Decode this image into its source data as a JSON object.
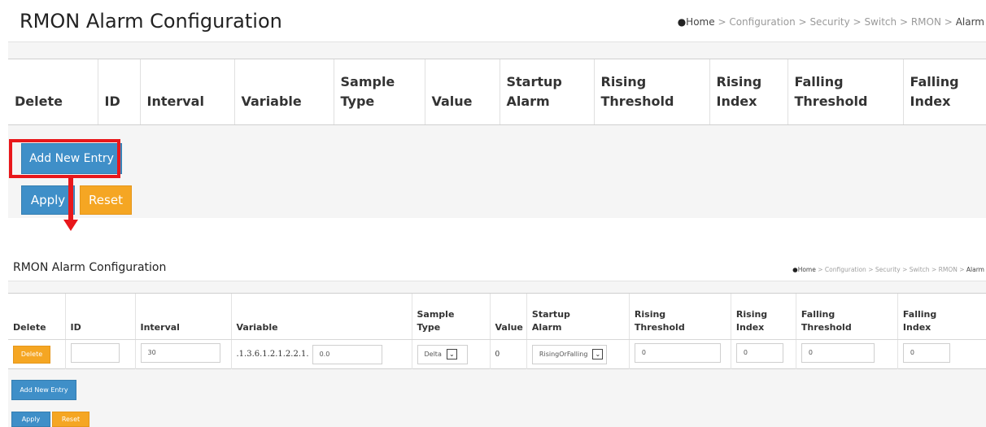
{
  "title": "RMON Alarm Configuration",
  "breadcrumb": [
    "Home",
    "Configuration",
    "Security",
    "Switch",
    "RMON",
    "Alarm"
  ],
  "breadcrumb_sep": ">",
  "headers": {
    "delete": "Delete",
    "id": "ID",
    "interval": "Interval",
    "variable": "Variable",
    "sample_type_1": "Sample",
    "sample_type_2": "Type",
    "value": "Value",
    "startup_alarm_1": "Startup",
    "startup_alarm_2": "Alarm",
    "rising_threshold_1": "Rising",
    "rising_threshold_2": "Threshold",
    "rising_index_1": "Rising",
    "rising_index_2": "Index",
    "falling_threshold_1": "Falling",
    "falling_threshold_2": "Threshold",
    "falling_index_1": "Falling",
    "falling_index_2": "Index"
  },
  "row": {
    "delete_label": "Delete",
    "id": "",
    "interval": "30",
    "variable_prefix": ".1.3.6.1.2.1.2.2.1.",
    "variable_suffix": "0.0",
    "sample_type": "Delta",
    "value": "0",
    "startup_alarm": "RisingOrFalling",
    "rising_threshold": "0",
    "rising_index": "0",
    "falling_threshold": "0",
    "falling_index": "0"
  },
  "buttons": {
    "add_new_entry": "Add New Entry",
    "apply": "Apply",
    "reset": "Reset"
  },
  "colors": {
    "primary_button": "#3f8fc8",
    "reset_button": "#f5a623",
    "highlight": "#e8171b"
  },
  "icons": {
    "home": "home-icon",
    "dropdown": "chevron-down-icon"
  }
}
